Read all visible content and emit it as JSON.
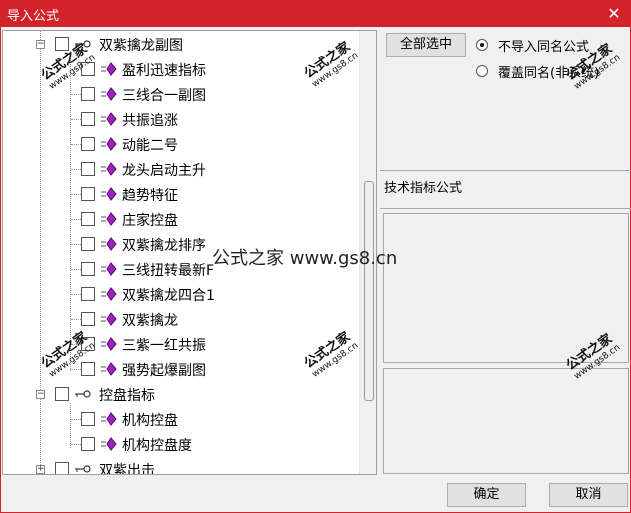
{
  "window": {
    "title": "导入公式",
    "close_glyph": "✕"
  },
  "tree": {
    "groups": [
      {
        "label": "双紫擒龙副图",
        "expander": "−",
        "items": [
          "盈利迅速指标",
          "三线合一副图",
          "共振追涨",
          "动能二号",
          "龙头启动主升",
          "趋势特征",
          "庄家控盘",
          "双紫擒龙排序",
          "三线扭转最新F",
          "双紫擒龙四合1",
          "双紫擒龙",
          "三紫一红共振",
          "强势起爆副图"
        ]
      },
      {
        "label": "控盘指标",
        "expander": "−",
        "items": [
          "机构控盘",
          "机构控盘度"
        ]
      },
      {
        "label": "双紫出击",
        "expander": "+",
        "items": []
      }
    ]
  },
  "right": {
    "select_all_label": "全部选中",
    "radio_skip_label": "不导入同名公式",
    "radio_overwrite_label": "覆盖同名(非系统)",
    "formula_type_label": "技术指标公式"
  },
  "footer": {
    "ok_label": "确定",
    "cancel_label": "取消"
  },
  "watermark": {
    "brand": "公式之家",
    "url": "www.gs8.cn",
    "center": "公式之家 www.gs8.cn"
  }
}
